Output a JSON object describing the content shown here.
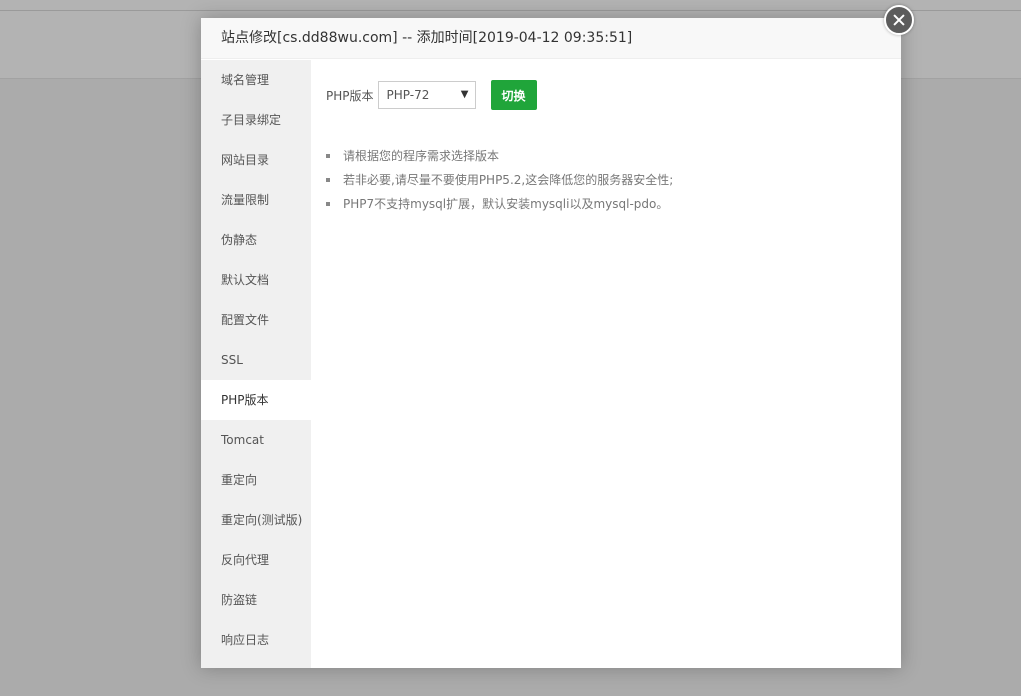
{
  "dialog": {
    "title": "站点修改[cs.dd88wu.com] -- 添加时间[2019-04-12 09:35:51]"
  },
  "sidebar": {
    "items": [
      {
        "label": "域名管理"
      },
      {
        "label": "子目录绑定"
      },
      {
        "label": "网站目录"
      },
      {
        "label": "流量限制"
      },
      {
        "label": "伪静态"
      },
      {
        "label": "默认文档"
      },
      {
        "label": "配置文件"
      },
      {
        "label": "SSL"
      },
      {
        "label": "PHP版本",
        "active": true
      },
      {
        "label": "Tomcat"
      },
      {
        "label": "重定向"
      },
      {
        "label": "重定向(测试版)"
      },
      {
        "label": "反向代理"
      },
      {
        "label": "防盗链"
      },
      {
        "label": "响应日志"
      }
    ]
  },
  "php": {
    "label": "PHP版本",
    "selected": "PHP-72",
    "switch_label": "切换"
  },
  "tips": [
    "请根据您的程序需求选择版本",
    "若非必要,请尽量不要使用PHP5.2,这会降低您的服务器安全性;",
    "PHP7不支持mysql扩展，默认安装mysqli以及mysql-pdo。"
  ],
  "colors": {
    "accent": "#20a53a",
    "overlay": "#ababab",
    "sidebar_bg": "#f0f0f0"
  }
}
